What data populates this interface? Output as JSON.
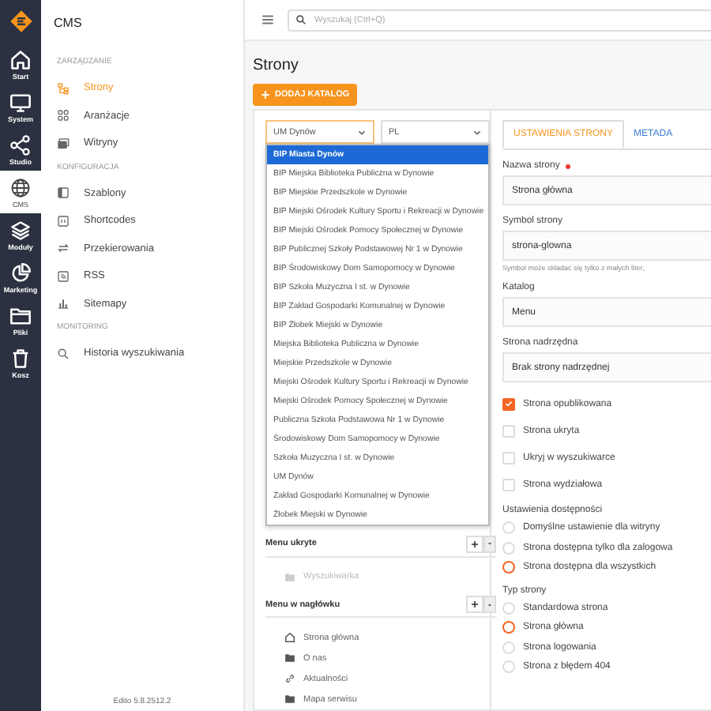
{
  "rail": {
    "items": [
      {
        "label": "Start",
        "selected": false
      },
      {
        "label": "System",
        "selected": false
      },
      {
        "label": "Studio",
        "selected": false
      },
      {
        "label": "CMS",
        "selected": true
      },
      {
        "label": "Moduły",
        "selected": false
      },
      {
        "label": "Marketing",
        "selected": false
      },
      {
        "label": "Pliki",
        "selected": false
      },
      {
        "label": "Kosz",
        "selected": false
      }
    ]
  },
  "sidebar": {
    "title": "CMS",
    "sections": [
      {
        "heading": "ZARZĄDZANIE",
        "items": [
          {
            "label": "Strony",
            "selected": true
          },
          {
            "label": "Aranżacje",
            "selected": false
          },
          {
            "label": "Witryny",
            "selected": false
          }
        ]
      },
      {
        "heading": "KONFIGURACJA",
        "items": [
          {
            "label": "Szablony",
            "selected": false
          },
          {
            "label": "Shortcodes",
            "selected": false
          },
          {
            "label": "Przekierowania",
            "selected": false
          },
          {
            "label": "RSS",
            "selected": false
          },
          {
            "label": "Sitemapy",
            "selected": false
          }
        ]
      },
      {
        "heading": "MONITORING",
        "items": [
          {
            "label": "Historia wyszukiwania",
            "selected": false
          }
        ]
      }
    ],
    "version": "Edito 5.8.2512.2"
  },
  "topbar": {
    "search": {
      "placeholder": "Wyszukaj (Ctrl+Q)"
    }
  },
  "page": {
    "title": "Strony",
    "add_button": "DODAJ KATALOG"
  },
  "filters": {
    "site_select": {
      "value": "UM Dynów",
      "expanded": true
    },
    "language_select": {
      "value": "PL"
    },
    "site_options": [
      {
        "label": "BIP Miasta Dynów",
        "selected": true
      },
      {
        "label": "BIP Miejska Biblioteka Publiczna w Dynowie",
        "selected": false
      },
      {
        "label": "BIP Miejskie Przedszkole w Dynowie",
        "selected": false
      },
      {
        "label": "BIP Miejski Ośrodek Kultury Sportu i Rekreacji w Dynowie",
        "selected": false
      },
      {
        "label": "BIP Miejski Ośrodek Pomocy Społecznej w Dynowie",
        "selected": false
      },
      {
        "label": "BIP Publicznej Szkoły Podstawowej Nr 1 w Dynowie",
        "selected": false
      },
      {
        "label": "BIP Środowiskowy Dom Samopomocy w Dynowie",
        "selected": false
      },
      {
        "label": "BIP Szkoła Muzyczna I st. w Dynowie",
        "selected": false
      },
      {
        "label": "BIP Zakład Gospodarki Komunalnej w Dynowie",
        "selected": false
      },
      {
        "label": "BIP Żłobek Miejski w Dynowie",
        "selected": false
      },
      {
        "label": "Miejska Biblioteka Publiczna w Dynowie",
        "selected": false
      },
      {
        "label": "Miejskie Przedszkole w Dynowie",
        "selected": false
      },
      {
        "label": "Miejski Ośrodek Kultury Sportu i Rekreacji w Dynowie",
        "selected": false
      },
      {
        "label": "Miejski Ośrodek Pomocy Społecznej w Dynowie",
        "selected": false
      },
      {
        "label": "Publiczna Szkoła Podstawowa Nr 1 w Dynowie",
        "selected": false
      },
      {
        "label": "Środowiskowy Dom Samopomocy w Dynowie",
        "selected": false
      },
      {
        "label": "Szkoła Muzyczna I st. w Dynowie",
        "selected": false
      },
      {
        "label": "UM Dynów",
        "selected": false
      },
      {
        "label": "Zakład Gospodarki Komunalnej w Dynowie",
        "selected": false
      },
      {
        "label": "Żłobek Miejski w Dynowie",
        "selected": false
      }
    ]
  },
  "menus": [
    {
      "title": "Menu ukryte",
      "items": [
        {
          "label": "Wyszukiwarka",
          "kind": "folder",
          "disabled": true
        }
      ]
    },
    {
      "title": "Menu w nagłówku",
      "items": [
        {
          "label": "Strona główna",
          "kind": "home",
          "disabled": false
        },
        {
          "label": "O nas",
          "kind": "folder",
          "disabled": false
        },
        {
          "label": "Aktualności",
          "kind": "link",
          "disabled": false
        },
        {
          "label": "Mapa serwisu",
          "kind": "folder",
          "disabled": false
        }
      ]
    }
  ],
  "form": {
    "tabs": [
      {
        "label": "USTAWIENIA STRONY",
        "selected": true
      },
      {
        "label": "METADA",
        "selected": false
      }
    ],
    "fields": [
      {
        "label": "Nazwa strony",
        "required": true,
        "value": "Strona główna"
      },
      {
        "label": "Symbol strony",
        "required": false,
        "value": "strona-glowna",
        "hint": "Symbol może składać się tylko z małych liter,"
      },
      {
        "label": "Katalog",
        "required": false,
        "value": "Menu"
      },
      {
        "label": "Strona nadrzędna",
        "required": false,
        "value": "Brak strony nadrzędnej"
      }
    ],
    "checkboxes": [
      {
        "label": "Strona opublikowana",
        "checked": true
      },
      {
        "label": "Strona ukryta",
        "checked": false
      },
      {
        "label": "Ukryj w wyszukiwarce",
        "checked": false
      },
      {
        "label": "Strona wydziałowa",
        "checked": false
      }
    ],
    "radio_groups": [
      {
        "label": "Ustawienia dostępności",
        "options": [
          {
            "label": "Domyślne ustawienie dla witryny",
            "selected": false
          },
          {
            "label": "Strona dostępna tylko dla zalogowa",
            "selected": false
          },
          {
            "label": "Strona dostępna dla wszystkich",
            "selected": true
          }
        ]
      },
      {
        "label": "Typ strony",
        "options": [
          {
            "label": "Standardowa strona",
            "selected": false
          },
          {
            "label": "Strona główna",
            "selected": true
          },
          {
            "label": "Strona logowania",
            "selected": false
          },
          {
            "label": "Strona z błędem 404",
            "selected": false
          }
        ]
      }
    ]
  }
}
